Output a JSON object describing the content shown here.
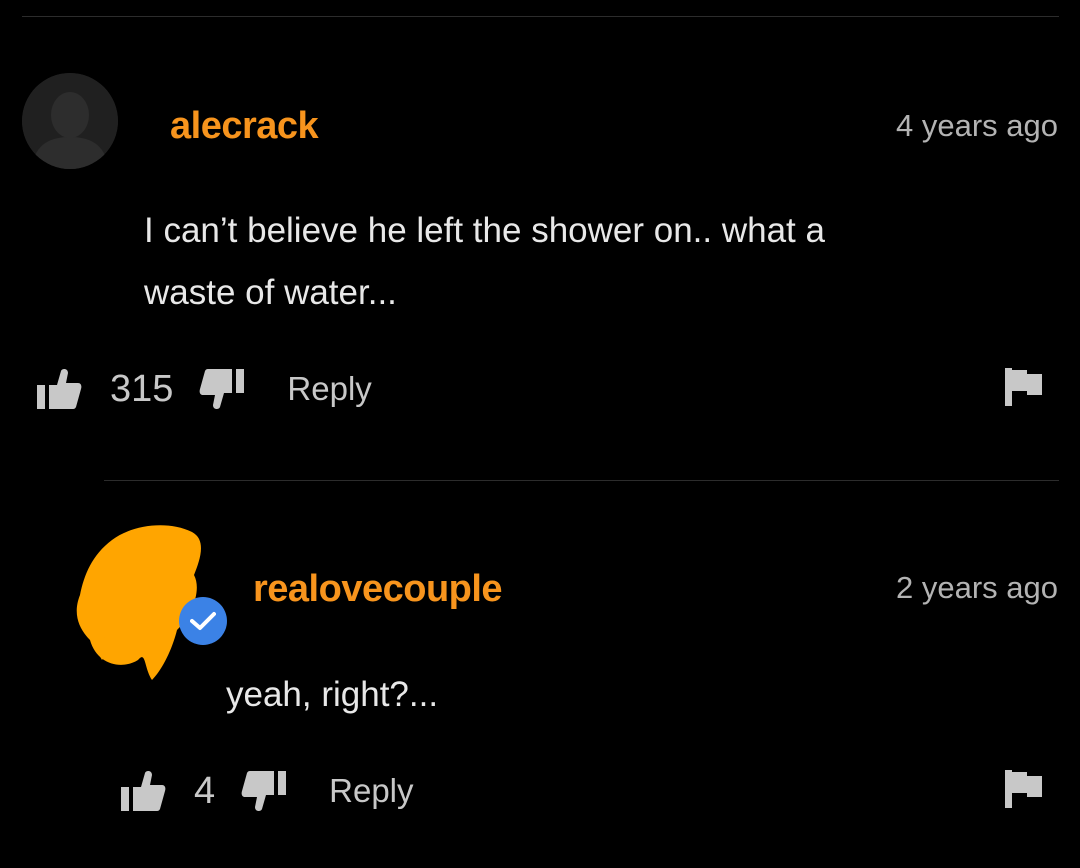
{
  "theme": {
    "accent": "#f7941d",
    "background": "#000000",
    "text": "#e8e8e8",
    "muted": "#b3b3b3",
    "verified_badge": "#3b82e6",
    "redaction": "#ffa500"
  },
  "comments": [
    {
      "username": "alecrack",
      "timestamp": "4 years ago",
      "text_line1": "I can’t believe he left the shower on.. what a",
      "text_line2": "waste of water...",
      "likes": "315",
      "reply_label": "Reply",
      "avatar": "default-user-avatar"
    },
    {
      "username": "realovecouple",
      "timestamp": "2 years ago",
      "text_line1": "yeah, right?...",
      "likes": "4",
      "reply_label": "Reply",
      "avatar": "redacted-avatar",
      "verified": true
    }
  ],
  "icons": {
    "like": "thumbs-up-icon",
    "dislike": "thumbs-down-icon",
    "report": "flag-icon",
    "verified": "verified-check-icon"
  }
}
